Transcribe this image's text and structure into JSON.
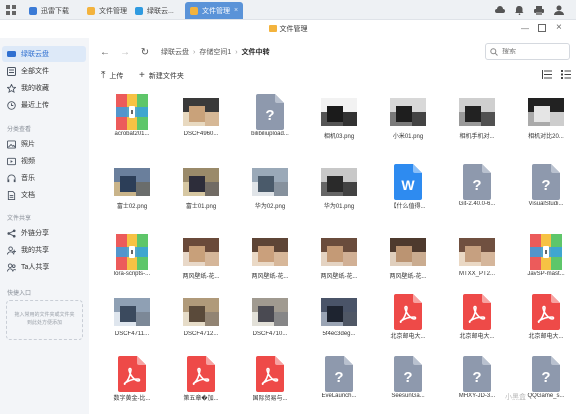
{
  "app": {
    "window_title": "文件管理"
  },
  "tabs": [
    {
      "label": "迅雷下载",
      "color": "#3b7bd6"
    },
    {
      "label": "文件管理",
      "color": "#f3b33d"
    },
    {
      "label": "绿联云...",
      "color": "#2f9be0"
    },
    {
      "label": "文件管理",
      "color": "#f3b33d",
      "active": true
    }
  ],
  "sidebar": {
    "items": [
      {
        "label": "绿联云盘",
        "icon": "cloud-drive-icon"
      },
      {
        "label": "全部文件",
        "icon": "all-files-icon"
      },
      {
        "label": "我的收藏",
        "icon": "star-icon"
      },
      {
        "label": "最近上传",
        "icon": "clock-icon"
      }
    ],
    "category_title": "分类查看",
    "categories": [
      {
        "label": "照片",
        "icon": "photo-icon"
      },
      {
        "label": "视频",
        "icon": "video-icon"
      },
      {
        "label": "音乐",
        "icon": "music-icon"
      },
      {
        "label": "文档",
        "icon": "doc-icon"
      }
    ],
    "share_title": "文件共享",
    "shares": [
      {
        "label": "外链分享",
        "icon": "link-share-icon"
      },
      {
        "label": "我的共享",
        "icon": "my-share-icon"
      },
      {
        "label": "Ta人共享",
        "icon": "others-share-icon"
      }
    ],
    "quick_title": "快捷入口",
    "quick_hint": "拖入常用的文件夹或文件夹到此处方便添加"
  },
  "toolbar": {
    "breadcrumb": [
      "绿联云盘",
      "存储空间1",
      "文件中转"
    ],
    "search_placeholder": "搜索",
    "upload_label": "上传",
    "new_folder_label": "新建文件夹"
  },
  "files": [
    {
      "name": "acrobat201...",
      "kind": "archive"
    },
    {
      "name": "DSCF4960...",
      "kind": "photo",
      "palette": [
        "#c9a27a",
        "#3a3a3a",
        "#e8d9c0"
      ]
    },
    {
      "name": "bilibiliupload...",
      "kind": "unknown"
    },
    {
      "name": "相机03.png",
      "kind": "photo",
      "palette": [
        "#1b1b1b",
        "#f2f2f2",
        "#555"
      ]
    },
    {
      "name": "小米01.png",
      "kind": "photo",
      "palette": [
        "#1e1e1e",
        "#d8d8d8",
        "#7a7a7a"
      ]
    },
    {
      "name": "相机手机对...",
      "kind": "photo",
      "palette": [
        "#222",
        "#cfcfcf",
        "#999"
      ]
    },
    {
      "name": "相机对比20...",
      "kind": "photo",
      "palette": [
        "#e5e5e5",
        "#222",
        "#aaa"
      ]
    },
    {
      "name": "富士02.png",
      "kind": "photo",
      "palette": [
        "#2c3e58",
        "#6a7f9c",
        "#c9b48a"
      ]
    },
    {
      "name": "富士01.png",
      "kind": "photo",
      "palette": [
        "#2d2d3a",
        "#9a8a6a",
        "#d6c7a2"
      ]
    },
    {
      "name": "华为02.png",
      "kind": "photo",
      "palette": [
        "#4a5a6a",
        "#9aa9b8",
        "#e0e4e8"
      ]
    },
    {
      "name": "华为01.png",
      "kind": "photo",
      "palette": [
        "#2a2a2a",
        "#c8c8c8",
        "#666"
      ]
    },
    {
      "name": "【什么值得...",
      "kind": "word"
    },
    {
      "name": "Git-2.40.0-6...",
      "kind": "unknown"
    },
    {
      "name": "VisualStudi...",
      "kind": "unknown"
    },
    {
      "name": "lora-scripts-...",
      "kind": "archive"
    },
    {
      "name": "两风壁纸-花...",
      "kind": "photo",
      "palette": [
        "#c8a07a",
        "#6a4a3a",
        "#e8d8c8"
      ]
    },
    {
      "name": "两风壁纸-花...",
      "kind": "photo",
      "palette": [
        "#caa07c",
        "#5e4536",
        "#ead9c6"
      ]
    },
    {
      "name": "两风壁纸-花...",
      "kind": "photo",
      "palette": [
        "#c49a76",
        "#6a4c3c",
        "#e4d3c2"
      ]
    },
    {
      "name": "两风壁纸-花...",
      "kind": "photo",
      "palette": [
        "#bb9472",
        "#4e3a2e",
        "#e0cfbd"
      ]
    },
    {
      "name": "MTXX_PT2...",
      "kind": "photo",
      "palette": [
        "#c6a080",
        "#705040",
        "#ead8c4"
      ]
    },
    {
      "name": "JavSP-mast...",
      "kind": "archive"
    },
    {
      "name": "DSCF4711...",
      "kind": "photo",
      "palette": [
        "#3b4a5e",
        "#8fa0b4",
        "#dfe6ee"
      ]
    },
    {
      "name": "DSCF4712...",
      "kind": "photo",
      "palette": [
        "#5a4a3a",
        "#b09a7a",
        "#e6dcc8"
      ]
    },
    {
      "name": "DSCF4710...",
      "kind": "photo",
      "palette": [
        "#4a4a52",
        "#a09a90",
        "#e2e0d8"
      ]
    },
    {
      "name": "5f4ec3deg...",
      "kind": "photo",
      "palette": [
        "#1e2430",
        "#4a5468",
        "#9aa4b4"
      ]
    },
    {
      "name": "北京邮电大...",
      "kind": "pdf"
    },
    {
      "name": "北京邮电大...",
      "kind": "pdf"
    },
    {
      "name": "北京邮电大...",
      "kind": "pdf"
    },
    {
      "name": "数字黄金-比...",
      "kind": "pdf"
    },
    {
      "name": "第五章�加...",
      "kind": "pdf"
    },
    {
      "name": "国际贸易与...",
      "kind": "pdf"
    },
    {
      "name": "EveLaunch...",
      "kind": "unknown"
    },
    {
      "name": "SeesunGa...",
      "kind": "unknown"
    },
    {
      "name": "MHXY-JD-3...",
      "kind": "unknown"
    },
    {
      "name": "QQGame_s...",
      "kind": "unknown"
    }
  ],
  "watermark": "小黑盒"
}
